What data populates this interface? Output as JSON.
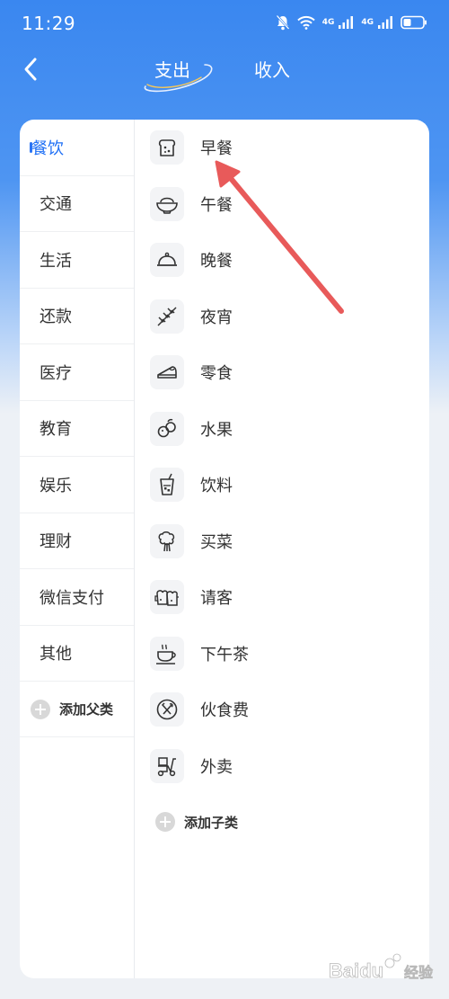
{
  "status_bar": {
    "time": "11:29",
    "network_label_1": "4G",
    "network_label_2": "4G",
    "icons": [
      "mute-bell-icon",
      "wifi-icon",
      "signal-icon",
      "signal-icon",
      "battery-icon"
    ]
  },
  "header": {
    "back_icon": "chevron-left-icon",
    "tabs": [
      {
        "label": "支出",
        "active": true
      },
      {
        "label": "收入",
        "active": false
      }
    ]
  },
  "parent_categories": [
    {
      "label": "餐饮",
      "active": true
    },
    {
      "label": "交通",
      "active": false
    },
    {
      "label": "生活",
      "active": false
    },
    {
      "label": "还款",
      "active": false
    },
    {
      "label": "医疗",
      "active": false
    },
    {
      "label": "教育",
      "active": false
    },
    {
      "label": "娱乐",
      "active": false
    },
    {
      "label": "理财",
      "active": false
    },
    {
      "label": "微信支付",
      "active": false
    },
    {
      "label": "其他",
      "active": false
    }
  ],
  "add_parent_label": "添加父类",
  "child_categories": [
    {
      "label": "早餐",
      "icon": "toast-icon"
    },
    {
      "label": "午餐",
      "icon": "rice-bowl-icon"
    },
    {
      "label": "晚餐",
      "icon": "cloche-icon"
    },
    {
      "label": "夜宵",
      "icon": "skewer-icon"
    },
    {
      "label": "零食",
      "icon": "cake-slice-icon"
    },
    {
      "label": "水果",
      "icon": "fruit-icon"
    },
    {
      "label": "饮料",
      "icon": "drink-cup-icon"
    },
    {
      "label": "买菜",
      "icon": "vegetable-icon"
    },
    {
      "label": "请客",
      "icon": "beer-mugs-icon"
    },
    {
      "label": "下午茶",
      "icon": "tea-cup-icon"
    },
    {
      "label": "伙食费",
      "icon": "fork-knife-icon"
    },
    {
      "label": "外卖",
      "icon": "delivery-scooter-icon"
    }
  ],
  "add_child_label": "添加子类",
  "colors": {
    "header_blue": "#3a87f0",
    "active_blue": "#1e6ff5",
    "annotation_red": "#e85a5a"
  },
  "watermark": {
    "text": "Baidu 经验"
  }
}
